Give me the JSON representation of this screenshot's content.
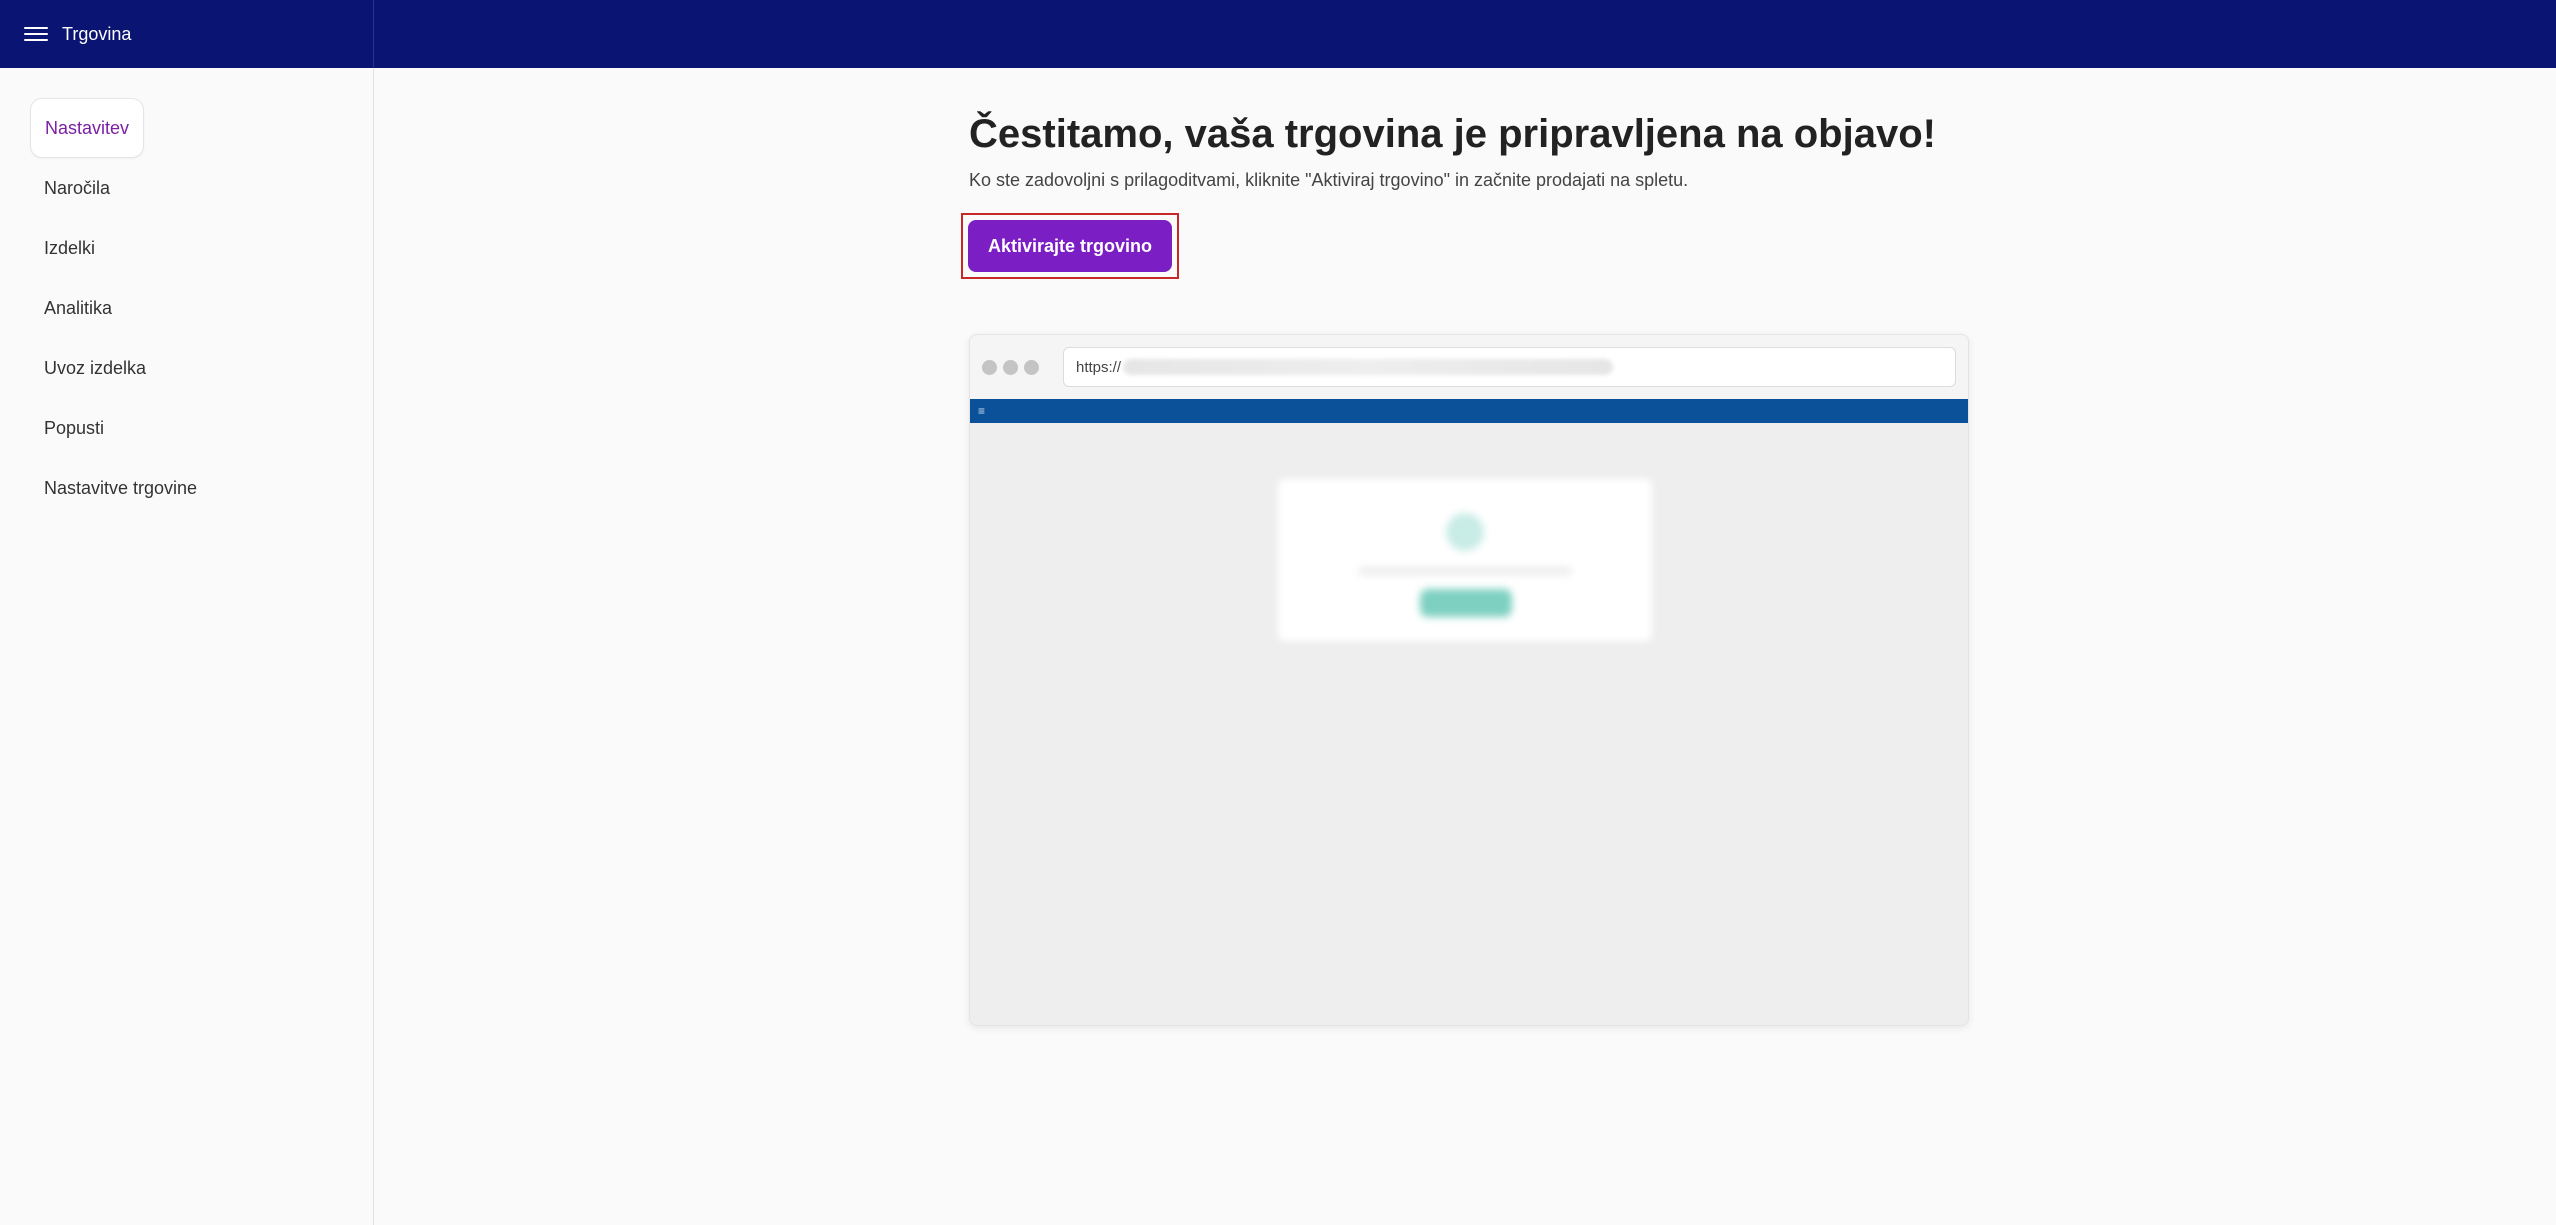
{
  "header": {
    "title": "Trgovina",
    "menu_icon": "hamburger-menu-icon"
  },
  "sidebar": {
    "items": [
      {
        "label": "Nastavitev",
        "active": true
      },
      {
        "label": "Naročila",
        "active": false
      },
      {
        "label": "Izdelki",
        "active": false
      },
      {
        "label": "Analitika",
        "active": false
      },
      {
        "label": "Uvoz izdelka",
        "active": false
      },
      {
        "label": "Popusti",
        "active": false
      },
      {
        "label": "Nastavitve trgovine",
        "active": false
      }
    ]
  },
  "main": {
    "heading": "Čestitamo, vaša trgovina je pripravljena na objavo!",
    "subtext": "Ko ste zadovoljni s prilagoditvami, kliknite \"Aktiviraj trgovino\" in začnite prodajati na spletu.",
    "activate_button": "Aktivirajte trgovino"
  },
  "preview": {
    "url_prefix": "https://",
    "nav_icon": "≡"
  },
  "colors": {
    "topbar": "#0a1473",
    "accent": "#7b1fc4",
    "active_nav": "#7b1fa2",
    "preview_nav": "#0a519a",
    "highlight_border": "#c62828"
  }
}
